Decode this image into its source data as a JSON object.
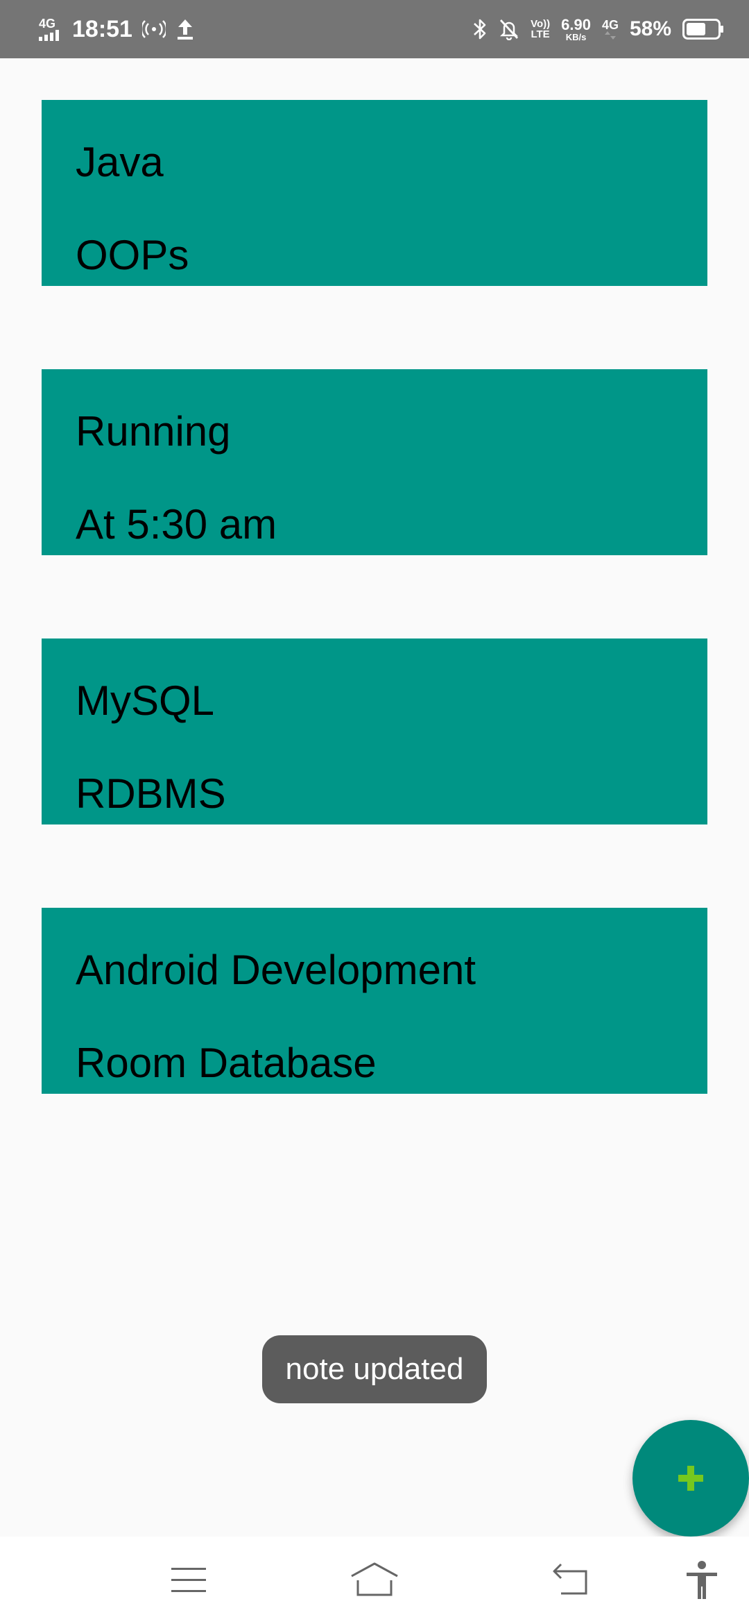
{
  "status_bar": {
    "network_type": "4G",
    "time": "18:51",
    "volte_top": "Vo))",
    "volte_bottom": "LTE",
    "speed_value": "6.90",
    "speed_unit": "KB/s",
    "network_type_right": "4G",
    "battery_percent": "58%",
    "icons": [
      "signal-icon",
      "hotspot-icon",
      "upload-icon",
      "bluetooth-icon",
      "notifications-off-icon",
      "battery-icon"
    ]
  },
  "notes": [
    {
      "title": "Java",
      "description": "OOPs"
    },
    {
      "title": "Running",
      "description": "At 5:30 am"
    },
    {
      "title": "MySQL",
      "description": "RDBMS"
    },
    {
      "title": "Android Development",
      "description": "Room Database"
    }
  ],
  "toast": {
    "message": "note updated"
  },
  "fab": {
    "icon": "plus-icon"
  },
  "nav_bar": {
    "icons": [
      "menu-icon",
      "home-icon",
      "back-icon",
      "accessibility-icon"
    ]
  },
  "colors": {
    "status_bar": "#757575",
    "card": "#009688",
    "fab": "#00897b",
    "fab_icon": "#76c81e",
    "toast": "#5c5c5c",
    "background": "#fafafa"
  }
}
